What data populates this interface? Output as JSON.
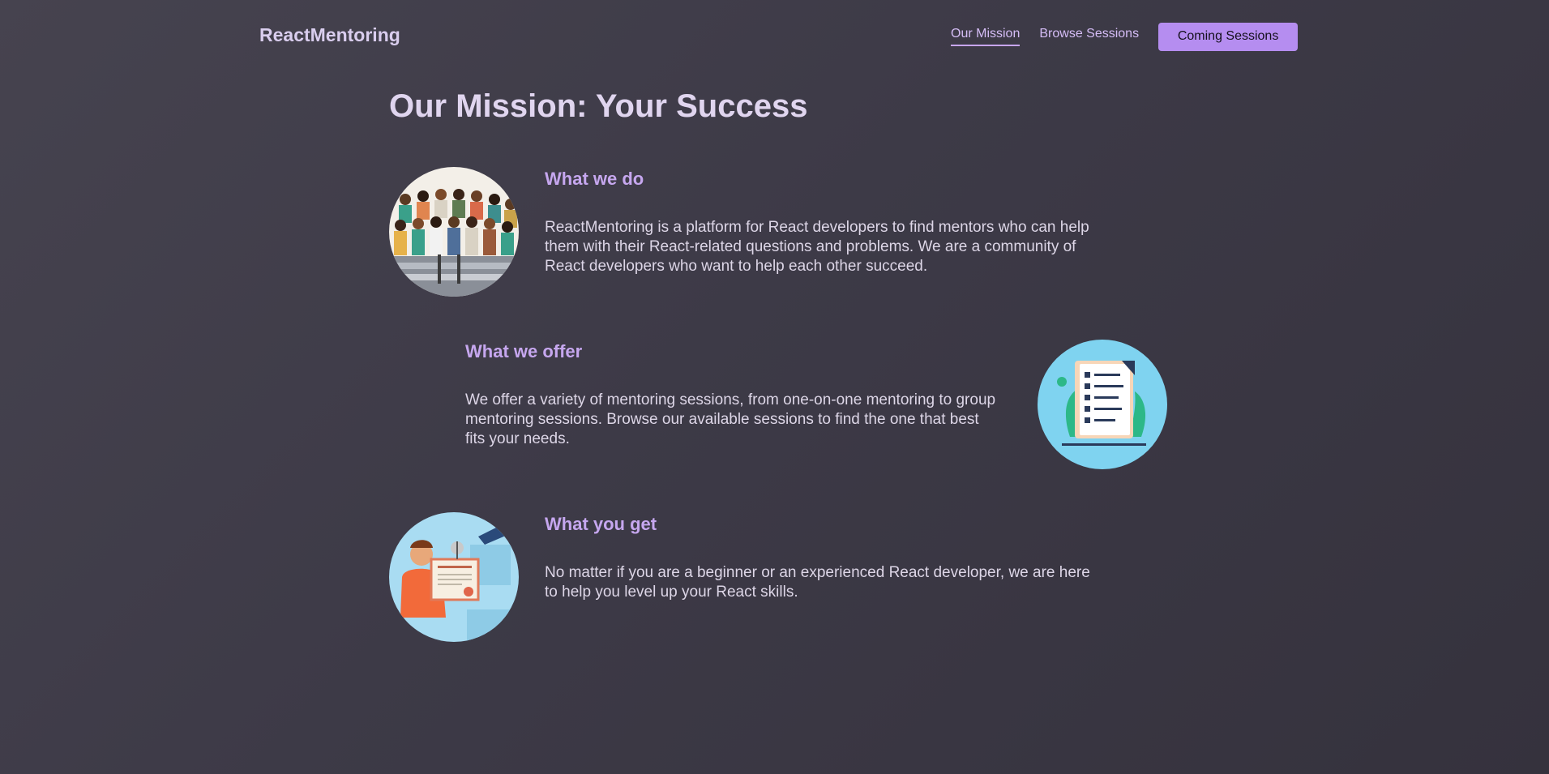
{
  "header": {
    "logo": "ReactMentoring",
    "nav": {
      "mission": "Our Mission",
      "browse": "Browse Sessions",
      "cta": "Coming Sessions"
    }
  },
  "page": {
    "title": "Our Mission: Your Success"
  },
  "sections": [
    {
      "heading": "What we do",
      "text": "ReactMentoring is a platform for React developers to find mentors who can help them with their React-related questions and problems. We are a community of React developers who want to help each other succeed.",
      "image": "community-illustration"
    },
    {
      "heading": "What we offer",
      "text": "We offer a variety of mentoring sessions, from one-on-one mentoring to group mentoring sessions. Browse our available sessions to find the one that best fits your needs.",
      "image": "checklist-illustration"
    },
    {
      "heading": "What you get",
      "text": "No matter if you are a beginner or an experienced React developer, we are here to help you level up your React skills.",
      "image": "certificate-illustration"
    }
  ],
  "colors": {
    "accent": "#b58df0",
    "heading": "#c6a7ef",
    "background": "#3d3a47"
  }
}
